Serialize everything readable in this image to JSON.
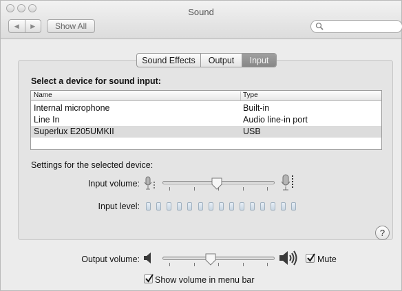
{
  "window": {
    "title": "Sound"
  },
  "toolbar": {
    "back_icon": "chevron-left-icon",
    "forward_icon": "chevron-right-icon",
    "show_all_label": "Show All",
    "search_placeholder": "",
    "search_value": ""
  },
  "tabs": [
    {
      "label": "Sound Effects",
      "selected": false
    },
    {
      "label": "Output",
      "selected": false
    },
    {
      "label": "Input",
      "selected": true
    }
  ],
  "device_list": {
    "heading": "Select a device for sound input:",
    "columns": [
      "Name",
      "Type"
    ],
    "rows": [
      {
        "name": "Internal microphone",
        "type": "Built-in",
        "selected": false
      },
      {
        "name": "Line In",
        "type": "Audio line-in port",
        "selected": false
      },
      {
        "name": "Superlux E205UMKII",
        "type": "USB",
        "selected": true
      }
    ]
  },
  "settings": {
    "heading": "Settings for the selected device:",
    "input_volume_label": "Input volume:",
    "input_volume_fraction": 0.48,
    "input_level_label": "Input level:",
    "input_level_segments": 15,
    "input_level_lit": 0
  },
  "footer": {
    "output_volume_label": "Output volume:",
    "output_volume_fraction": 0.42,
    "mute_label": "Mute",
    "mute_checked": true,
    "show_volume_label": "Show volume in menu bar",
    "show_volume_checked": true
  },
  "help": {
    "label": "?"
  },
  "colors": {
    "selected_tab": "#8f8f8f",
    "selected_row": "#dcdcdc",
    "window_bg": "#ececec"
  }
}
